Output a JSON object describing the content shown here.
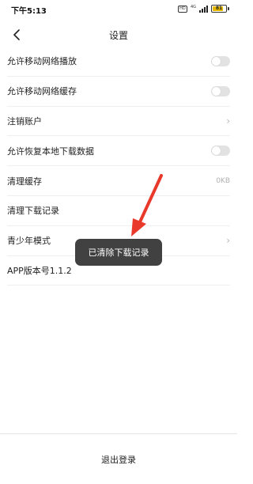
{
  "status_bar": {
    "time": "下午5:13",
    "network_label": "4G",
    "sim_label": "HD",
    "battery_level_text": "81",
    "battery_level": 0.81
  },
  "header": {
    "title": "设置",
    "back_icon": "chevron-left-icon"
  },
  "settings": {
    "items": [
      {
        "label": "允许移动网络播放",
        "control": "toggle",
        "on": false
      },
      {
        "label": "允许移动网络缓存",
        "control": "toggle",
        "on": false
      },
      {
        "label": "注销账户",
        "control": "chevron",
        "chevron": "›"
      },
      {
        "label": "允许恢复本地下载数据",
        "control": "toggle",
        "on": false
      },
      {
        "label": "清理缓存",
        "control": "value",
        "value": "0KB"
      },
      {
        "label": "清理下载记录",
        "control": "none"
      },
      {
        "label": "青少年模式",
        "control": "chevron",
        "chevron": "›"
      },
      {
        "label": "APP版本号1.1.2",
        "control": "none"
      }
    ]
  },
  "toast": {
    "message": "已清除下载记录"
  },
  "footer": {
    "logout_label": "退出登录"
  },
  "colors": {
    "arrow": "#e8392b",
    "toast_bg": "#373737",
    "toggle_off": "#e2e2e2",
    "battery": "#e6b800"
  }
}
